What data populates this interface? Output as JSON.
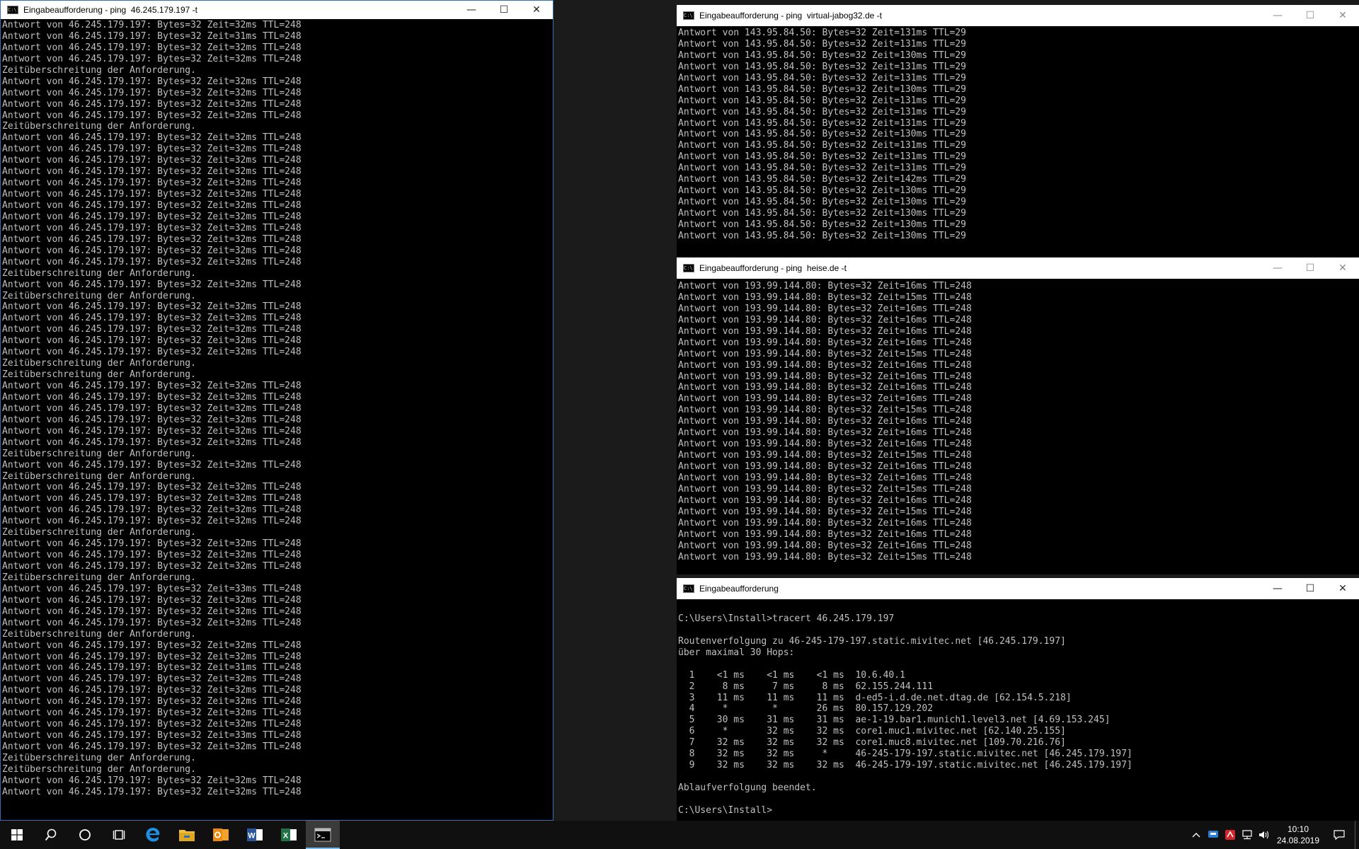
{
  "windows": {
    "ping_main": {
      "title": "Eingabeaufforderung - ping  46.245.179.197 -t",
      "lines": [
        "Antwort von 46.245.179.197: Bytes=32 Zeit=32ms TTL=248",
        "Antwort von 46.245.179.197: Bytes=32 Zeit=31ms TTL=248",
        "Antwort von 46.245.179.197: Bytes=32 Zeit=32ms TTL=248",
        "Antwort von 46.245.179.197: Bytes=32 Zeit=32ms TTL=248",
        "Zeitüberschreitung der Anforderung.",
        "Antwort von 46.245.179.197: Bytes=32 Zeit=32ms TTL=248",
        "Antwort von 46.245.179.197: Bytes=32 Zeit=32ms TTL=248",
        "Antwort von 46.245.179.197: Bytes=32 Zeit=32ms TTL=248",
        "Antwort von 46.245.179.197: Bytes=32 Zeit=32ms TTL=248",
        "Zeitüberschreitung der Anforderung.",
        "Antwort von 46.245.179.197: Bytes=32 Zeit=32ms TTL=248",
        "Antwort von 46.245.179.197: Bytes=32 Zeit=32ms TTL=248",
        "Antwort von 46.245.179.197: Bytes=32 Zeit=32ms TTL=248",
        "Antwort von 46.245.179.197: Bytes=32 Zeit=32ms TTL=248",
        "Antwort von 46.245.179.197: Bytes=32 Zeit=32ms TTL=248",
        "Antwort von 46.245.179.197: Bytes=32 Zeit=32ms TTL=248",
        "Antwort von 46.245.179.197: Bytes=32 Zeit=32ms TTL=248",
        "Antwort von 46.245.179.197: Bytes=32 Zeit=32ms TTL=248",
        "Antwort von 46.245.179.197: Bytes=32 Zeit=32ms TTL=248",
        "Antwort von 46.245.179.197: Bytes=32 Zeit=32ms TTL=248",
        "Antwort von 46.245.179.197: Bytes=32 Zeit=32ms TTL=248",
        "Antwort von 46.245.179.197: Bytes=32 Zeit=32ms TTL=248",
        "Zeitüberschreitung der Anforderung.",
        "Antwort von 46.245.179.197: Bytes=32 Zeit=32ms TTL=248",
        "Zeitüberschreitung der Anforderung.",
        "Antwort von 46.245.179.197: Bytes=32 Zeit=32ms TTL=248",
        "Antwort von 46.245.179.197: Bytes=32 Zeit=32ms TTL=248",
        "Antwort von 46.245.179.197: Bytes=32 Zeit=32ms TTL=248",
        "Antwort von 46.245.179.197: Bytes=32 Zeit=32ms TTL=248",
        "Antwort von 46.245.179.197: Bytes=32 Zeit=32ms TTL=248",
        "Zeitüberschreitung der Anforderung.",
        "Zeitüberschreitung der Anforderung.",
        "Antwort von 46.245.179.197: Bytes=32 Zeit=32ms TTL=248",
        "Antwort von 46.245.179.197: Bytes=32 Zeit=32ms TTL=248",
        "Antwort von 46.245.179.197: Bytes=32 Zeit=32ms TTL=248",
        "Antwort von 46.245.179.197: Bytes=32 Zeit=32ms TTL=248",
        "Antwort von 46.245.179.197: Bytes=32 Zeit=32ms TTL=248",
        "Antwort von 46.245.179.197: Bytes=32 Zeit=32ms TTL=248",
        "Zeitüberschreitung der Anforderung.",
        "Antwort von 46.245.179.197: Bytes=32 Zeit=32ms TTL=248",
        "Zeitüberschreitung der Anforderung.",
        "Antwort von 46.245.179.197: Bytes=32 Zeit=32ms TTL=248",
        "Antwort von 46.245.179.197: Bytes=32 Zeit=32ms TTL=248",
        "Antwort von 46.245.179.197: Bytes=32 Zeit=32ms TTL=248",
        "Antwort von 46.245.179.197: Bytes=32 Zeit=32ms TTL=248",
        "Zeitüberschreitung der Anforderung.",
        "Antwort von 46.245.179.197: Bytes=32 Zeit=32ms TTL=248",
        "Antwort von 46.245.179.197: Bytes=32 Zeit=32ms TTL=248",
        "Antwort von 46.245.179.197: Bytes=32 Zeit=32ms TTL=248",
        "Zeitüberschreitung der Anforderung.",
        "Antwort von 46.245.179.197: Bytes=32 Zeit=33ms TTL=248",
        "Antwort von 46.245.179.197: Bytes=32 Zeit=32ms TTL=248",
        "Antwort von 46.245.179.197: Bytes=32 Zeit=32ms TTL=248",
        "Antwort von 46.245.179.197: Bytes=32 Zeit=32ms TTL=248",
        "Zeitüberschreitung der Anforderung.",
        "Antwort von 46.245.179.197: Bytes=32 Zeit=32ms TTL=248",
        "Antwort von 46.245.179.197: Bytes=32 Zeit=32ms TTL=248",
        "Antwort von 46.245.179.197: Bytes=32 Zeit=31ms TTL=248",
        "Antwort von 46.245.179.197: Bytes=32 Zeit=32ms TTL=248",
        "Antwort von 46.245.179.197: Bytes=32 Zeit=32ms TTL=248",
        "Antwort von 46.245.179.197: Bytes=32 Zeit=32ms TTL=248",
        "Antwort von 46.245.179.197: Bytes=32 Zeit=32ms TTL=248",
        "Antwort von 46.245.179.197: Bytes=32 Zeit=32ms TTL=248",
        "Antwort von 46.245.179.197: Bytes=32 Zeit=33ms TTL=248",
        "Antwort von 46.245.179.197: Bytes=32 Zeit=32ms TTL=248",
        "Zeitüberschreitung der Anforderung.",
        "Zeitüberschreitung der Anforderung.",
        "Antwort von 46.245.179.197: Bytes=32 Zeit=32ms TTL=248",
        "Antwort von 46.245.179.197: Bytes=32 Zeit=32ms TTL=248"
      ]
    },
    "ping_jabog": {
      "title": "Eingabeaufforderung - ping  virtual-jabog32.de -t",
      "lines": [
        "Antwort von 143.95.84.50: Bytes=32 Zeit=131ms TTL=29",
        "Antwort von 143.95.84.50: Bytes=32 Zeit=131ms TTL=29",
        "Antwort von 143.95.84.50: Bytes=32 Zeit=130ms TTL=29",
        "Antwort von 143.95.84.50: Bytes=32 Zeit=131ms TTL=29",
        "Antwort von 143.95.84.50: Bytes=32 Zeit=131ms TTL=29",
        "Antwort von 143.95.84.50: Bytes=32 Zeit=130ms TTL=29",
        "Antwort von 143.95.84.50: Bytes=32 Zeit=131ms TTL=29",
        "Antwort von 143.95.84.50: Bytes=32 Zeit=131ms TTL=29",
        "Antwort von 143.95.84.50: Bytes=32 Zeit=131ms TTL=29",
        "Antwort von 143.95.84.50: Bytes=32 Zeit=130ms TTL=29",
        "Antwort von 143.95.84.50: Bytes=32 Zeit=131ms TTL=29",
        "Antwort von 143.95.84.50: Bytes=32 Zeit=131ms TTL=29",
        "Antwort von 143.95.84.50: Bytes=32 Zeit=131ms TTL=29",
        "Antwort von 143.95.84.50: Bytes=32 Zeit=142ms TTL=29",
        "Antwort von 143.95.84.50: Bytes=32 Zeit=130ms TTL=29",
        "Antwort von 143.95.84.50: Bytes=32 Zeit=130ms TTL=29",
        "Antwort von 143.95.84.50: Bytes=32 Zeit=130ms TTL=29",
        "Antwort von 143.95.84.50: Bytes=32 Zeit=130ms TTL=29",
        "Antwort von 143.95.84.50: Bytes=32 Zeit=130ms TTL=29"
      ]
    },
    "ping_heise": {
      "title": "Eingabeaufforderung - ping  heise.de -t",
      "lines": [
        "Antwort von 193.99.144.80: Bytes=32 Zeit=16ms TTL=248",
        "Antwort von 193.99.144.80: Bytes=32 Zeit=15ms TTL=248",
        "Antwort von 193.99.144.80: Bytes=32 Zeit=16ms TTL=248",
        "Antwort von 193.99.144.80: Bytes=32 Zeit=16ms TTL=248",
        "Antwort von 193.99.144.80: Bytes=32 Zeit=16ms TTL=248",
        "Antwort von 193.99.144.80: Bytes=32 Zeit=16ms TTL=248",
        "Antwort von 193.99.144.80: Bytes=32 Zeit=15ms TTL=248",
        "Antwort von 193.99.144.80: Bytes=32 Zeit=16ms TTL=248",
        "Antwort von 193.99.144.80: Bytes=32 Zeit=16ms TTL=248",
        "Antwort von 193.99.144.80: Bytes=32 Zeit=16ms TTL=248",
        "Antwort von 193.99.144.80: Bytes=32 Zeit=16ms TTL=248",
        "Antwort von 193.99.144.80: Bytes=32 Zeit=15ms TTL=248",
        "Antwort von 193.99.144.80: Bytes=32 Zeit=16ms TTL=248",
        "Antwort von 193.99.144.80: Bytes=32 Zeit=16ms TTL=248",
        "Antwort von 193.99.144.80: Bytes=32 Zeit=16ms TTL=248",
        "Antwort von 193.99.144.80: Bytes=32 Zeit=15ms TTL=248",
        "Antwort von 193.99.144.80: Bytes=32 Zeit=16ms TTL=248",
        "Antwort von 193.99.144.80: Bytes=32 Zeit=16ms TTL=248",
        "Antwort von 193.99.144.80: Bytes=32 Zeit=15ms TTL=248",
        "Antwort von 193.99.144.80: Bytes=32 Zeit=16ms TTL=248",
        "Antwort von 193.99.144.80: Bytes=32 Zeit=15ms TTL=248",
        "Antwort von 193.99.144.80: Bytes=32 Zeit=16ms TTL=248",
        "Antwort von 193.99.144.80: Bytes=32 Zeit=16ms TTL=248",
        "Antwort von 193.99.144.80: Bytes=32 Zeit=16ms TTL=248",
        "Antwort von 193.99.144.80: Bytes=32 Zeit=15ms TTL=248"
      ]
    },
    "tracert": {
      "title": "Eingabeaufforderung",
      "lines": [
        "",
        "C:\\Users\\Install>tracert 46.245.179.197",
        "",
        "Routenverfolgung zu 46-245-179-197.static.mivitec.net [46.245.179.197]",
        "über maximal 30 Hops:",
        "",
        "  1    <1 ms    <1 ms    <1 ms  10.6.40.1",
        "  2     8 ms     7 ms     8 ms  62.155.244.111",
        "  3    11 ms    11 ms    11 ms  d-ed5-i.d.de.net.dtag.de [62.154.5.218]",
        "  4     *        *       26 ms  80.157.129.202",
        "  5    30 ms    31 ms    31 ms  ae-1-19.bar1.munich1.level3.net [4.69.153.245]",
        "  6     *       32 ms    32 ms  core1.muc1.mivitec.net [62.140.25.155]",
        "  7    32 ms    32 ms    32 ms  core1.muc8.mivitec.net [109.70.216.76]",
        "  8    32 ms    32 ms     *     46-245-179-197.static.mivitec.net [46.245.179.197]",
        "  9    32 ms    32 ms    32 ms  46-245-179-197.static.mivitec.net [46.245.179.197]",
        "",
        "Ablaufverfolgung beendet.",
        "",
        "C:\\Users\\Install>"
      ]
    }
  },
  "window_controls": {
    "minimize": "—",
    "maximize": "☐",
    "close": "✕"
  },
  "taskbar": {
    "apps": [
      {
        "name": "start",
        "icon": "windows-logo-icon"
      },
      {
        "name": "search",
        "icon": "search-icon"
      },
      {
        "name": "cortana",
        "icon": "cortana-circle-icon"
      },
      {
        "name": "task-view",
        "icon": "task-view-icon"
      },
      {
        "name": "edge",
        "icon": "edge-icon"
      },
      {
        "name": "explorer",
        "icon": "folder-icon"
      },
      {
        "name": "outlook",
        "icon": "outlook-icon"
      },
      {
        "name": "word",
        "icon": "word-icon"
      },
      {
        "name": "excel",
        "icon": "excel-icon"
      },
      {
        "name": "cmd",
        "icon": "cmd-icon"
      }
    ],
    "clock": {
      "time": "10:10",
      "date": "24.08.2019"
    }
  },
  "colors": {
    "console_bg": "#000000",
    "console_text": "#c0c0c0",
    "titlebar_bg": "#ffffff",
    "taskbar_bg": "#101010",
    "accent": "#76b9ed",
    "word_blue": "#2b579a",
    "excel_green": "#217346",
    "outlook_blue": "#0f6cbd",
    "folder_yellow": "#f4c23a"
  }
}
